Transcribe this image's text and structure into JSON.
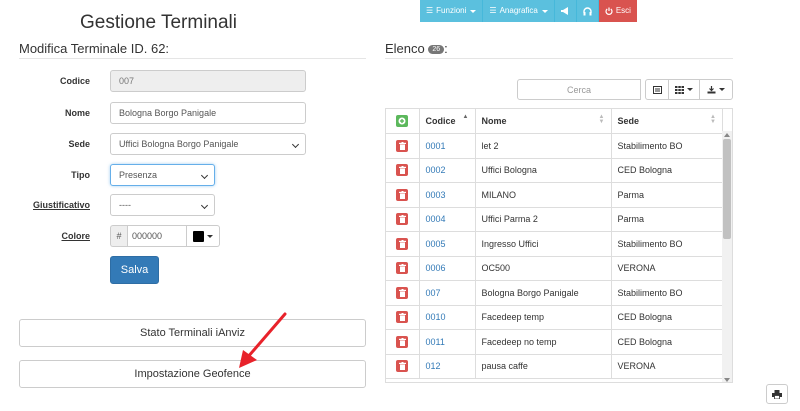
{
  "nav": {
    "functions": "Funzioni",
    "registry": "Anagrafica",
    "exit": "Esci"
  },
  "page_title": "Gestione Terminali",
  "edit_title": "Modifica Terminale ID. 62:",
  "form": {
    "code_label": "Codice",
    "code_value": "007",
    "name_label": "Nome",
    "name_value": "Bologna Borgo Panigale",
    "site_label": "Sede",
    "site_value": "Uffici Bologna Borgo Panigale",
    "type_label": "Tipo",
    "type_value": "Presenza",
    "justification_label": "Giustificativo",
    "justification_value": "----",
    "color_label": "Colore",
    "color_prefix": "#",
    "color_value": "000000",
    "color_swatch": "#000000",
    "save_label": "Salva"
  },
  "buttons": {
    "status": "Stato Terminali iAnviz",
    "geofence": "Impostazione Geofence"
  },
  "list": {
    "title": "Elenco",
    "count": "26",
    "title_suffix": ":",
    "search_placeholder": "Cerca",
    "columns": [
      "Codice",
      "Nome",
      "Sede"
    ],
    "rows": [
      {
        "code": "0001",
        "name": "let 2",
        "site": "Stabilimento BO"
      },
      {
        "code": "0002",
        "name": "Uffici Bologna",
        "site": "CED Bologna"
      },
      {
        "code": "0003",
        "name": "MILANO",
        "site": "Parma"
      },
      {
        "code": "0004",
        "name": "Uffici Parma 2",
        "site": "Parma"
      },
      {
        "code": "0005",
        "name": "Ingresso Uffici",
        "site": "Stabilimento BO"
      },
      {
        "code": "0006",
        "name": "OC500",
        "site": "VERONA"
      },
      {
        "code": "007",
        "name": "Bologna Borgo Panigale",
        "site": "Stabilimento BO"
      },
      {
        "code": "0010",
        "name": "Facedeep temp",
        "site": "CED Bologna"
      },
      {
        "code": "0011",
        "name": "Facedeep no temp",
        "site": "CED Bologna"
      },
      {
        "code": "012",
        "name": "pausa caffe",
        "site": "VERONA"
      }
    ]
  },
  "colors": {
    "info": "#5bc0de",
    "danger": "#d9534f",
    "success": "#5cb85c",
    "primary": "#337ab7",
    "annotation_arrow": "#e8222a"
  }
}
